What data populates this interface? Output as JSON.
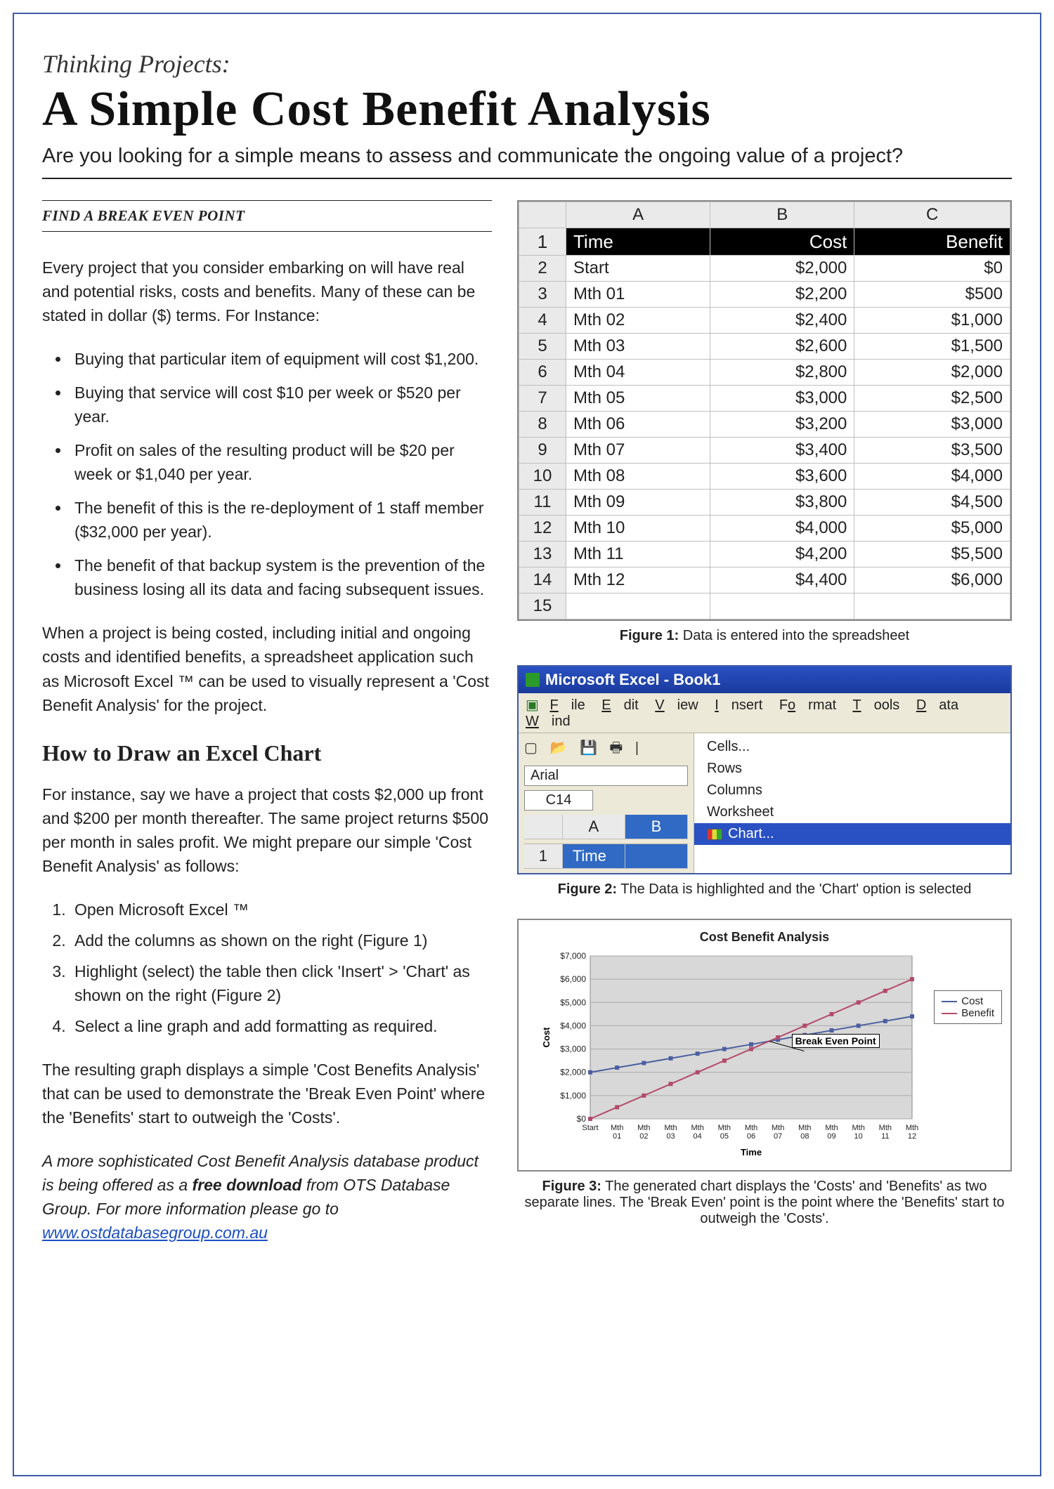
{
  "header": {
    "kicker": "Thinking Projects:",
    "title": "A Simple Cost Benefit Analysis",
    "subtitle": "Are you looking for a simple means to assess and communicate the ongoing value of a project?"
  },
  "left": {
    "section_label": "FIND A BREAK EVEN POINT",
    "intro": "Every project that you consider embarking on will have real and potential risks, costs and benefits.  Many of these can be stated in dollar ($) terms.  For Instance:",
    "bullets": [
      "Buying that particular item of equipment will cost $1,200.",
      "Buying that service will cost $10 per week or $520 per year.",
      "Profit on sales of the resulting product will be $20 per week or $1,040 per year.",
      "The benefit of this is the re-deployment of 1 staff member ($32,000 per year).",
      "The benefit of that backup system is the prevention of the business losing all its data and facing subsequent issues."
    ],
    "after_bullets": "When a project is being costed, including initial and ongoing costs and identified benefits, a spreadsheet application such as Microsoft Excel ™ can be used to visually represent a 'Cost Benefit Analysis' for the project.",
    "how_heading": "How to Draw an Excel Chart",
    "how_intro": "For instance, say we have a project that costs $2,000 up front and $200 per month thereafter. The same project returns $500 per month in sales profit.  We might prepare our simple 'Cost Benefit Analysis' as follows:",
    "steps": [
      "Open Microsoft Excel ™",
      "Add the columns as shown on the right (Figure 1)",
      "Highlight (select) the table then click 'Insert' > 'Chart' as shown on the right (Figure 2)",
      "Select a line graph and add formatting as required."
    ],
    "result": "The resulting graph displays a simple 'Cost Benefits Analysis' that can be used to demonstrate the 'Break Even Point' where the 'Benefits' start to outweigh the 'Costs'.",
    "footnote_pre": "A more sophisticated Cost Benefit Analysis database product is being offered as a ",
    "footnote_bold": "free download",
    "footnote_mid": " from OTS Database Group.  For more information please go to ",
    "footnote_link": "www.ostdatabasegroup.com.au"
  },
  "figure1": {
    "col_headers": [
      "A",
      "B",
      "C"
    ],
    "header_row": [
      "Time",
      "Cost",
      "Benefit"
    ],
    "rows": [
      [
        "Start",
        "$2,000",
        "$0"
      ],
      [
        "Mth 01",
        "$2,200",
        "$500"
      ],
      [
        "Mth 02",
        "$2,400",
        "$1,000"
      ],
      [
        "Mth 03",
        "$2,600",
        "$1,500"
      ],
      [
        "Mth 04",
        "$2,800",
        "$2,000"
      ],
      [
        "Mth 05",
        "$3,000",
        "$2,500"
      ],
      [
        "Mth 06",
        "$3,200",
        "$3,000"
      ],
      [
        "Mth 07",
        "$3,400",
        "$3,500"
      ],
      [
        "Mth 08",
        "$3,600",
        "$4,000"
      ],
      [
        "Mth 09",
        "$3,800",
        "$4,500"
      ],
      [
        "Mth 10",
        "$4,000",
        "$5,000"
      ],
      [
        "Mth 11",
        "$4,200",
        "$5,500"
      ],
      [
        "Mth 12",
        "$4,400",
        "$6,000"
      ]
    ],
    "caption_b": "Figure 1:",
    "caption": " Data is entered into the spreadsheet"
  },
  "figure2": {
    "window_title": "Microsoft Excel - Book1",
    "menus": [
      "File",
      "Edit",
      "View",
      "Insert",
      "Format",
      "Tools",
      "Data",
      "Wind"
    ],
    "font_name": "Arial",
    "name_box": "C14",
    "insert_items": [
      "Cells...",
      "Rows",
      "Columns",
      "Worksheet",
      "Chart..."
    ],
    "grid_col_a": "A",
    "grid_col_b": "B",
    "grid_row1": "1",
    "grid_a1": "Time",
    "caption_b": "Figure 2:",
    "caption": "  The Data is highlighted and the 'Chart' option is selected"
  },
  "figure3": {
    "caption_b": "Figure 3:",
    "caption": " The generated chart displays the 'Costs' and 'Benefits' as two separate lines.  The 'Break Even' point is the point where the 'Benefits' start to outweigh the 'Costs'."
  },
  "chart_data": {
    "type": "line",
    "title": "Cost Benefit Analysis",
    "xlabel": "Time",
    "ylabel": "Cost",
    "ylim": [
      0,
      7000
    ],
    "yticks": [
      0,
      1000,
      2000,
      3000,
      4000,
      5000,
      6000,
      7000
    ],
    "ytick_labels": [
      "$0",
      "$1,000",
      "$2,000",
      "$3,000",
      "$4,000",
      "$5,000",
      "$6,000",
      "$7,000"
    ],
    "categories": [
      "Start",
      "Mth 01",
      "Mth 02",
      "Mth 03",
      "Mth 04",
      "Mth 05",
      "Mth 06",
      "Mth 07",
      "Mth 08",
      "Mth 09",
      "Mth 10",
      "Mth 11",
      "Mth 12"
    ],
    "series": [
      {
        "name": "Cost",
        "color": "#4a5ea0",
        "values": [
          2000,
          2200,
          2400,
          2600,
          2800,
          3000,
          3200,
          3400,
          3600,
          3800,
          4000,
          4200,
          4400
        ]
      },
      {
        "name": "Benefit",
        "color": "#b34a6a",
        "values": [
          0,
          500,
          1000,
          1500,
          2000,
          2500,
          3000,
          3500,
          4000,
          4500,
          5000,
          5500,
          6000
        ]
      }
    ],
    "annotation": "Break Even Point"
  }
}
